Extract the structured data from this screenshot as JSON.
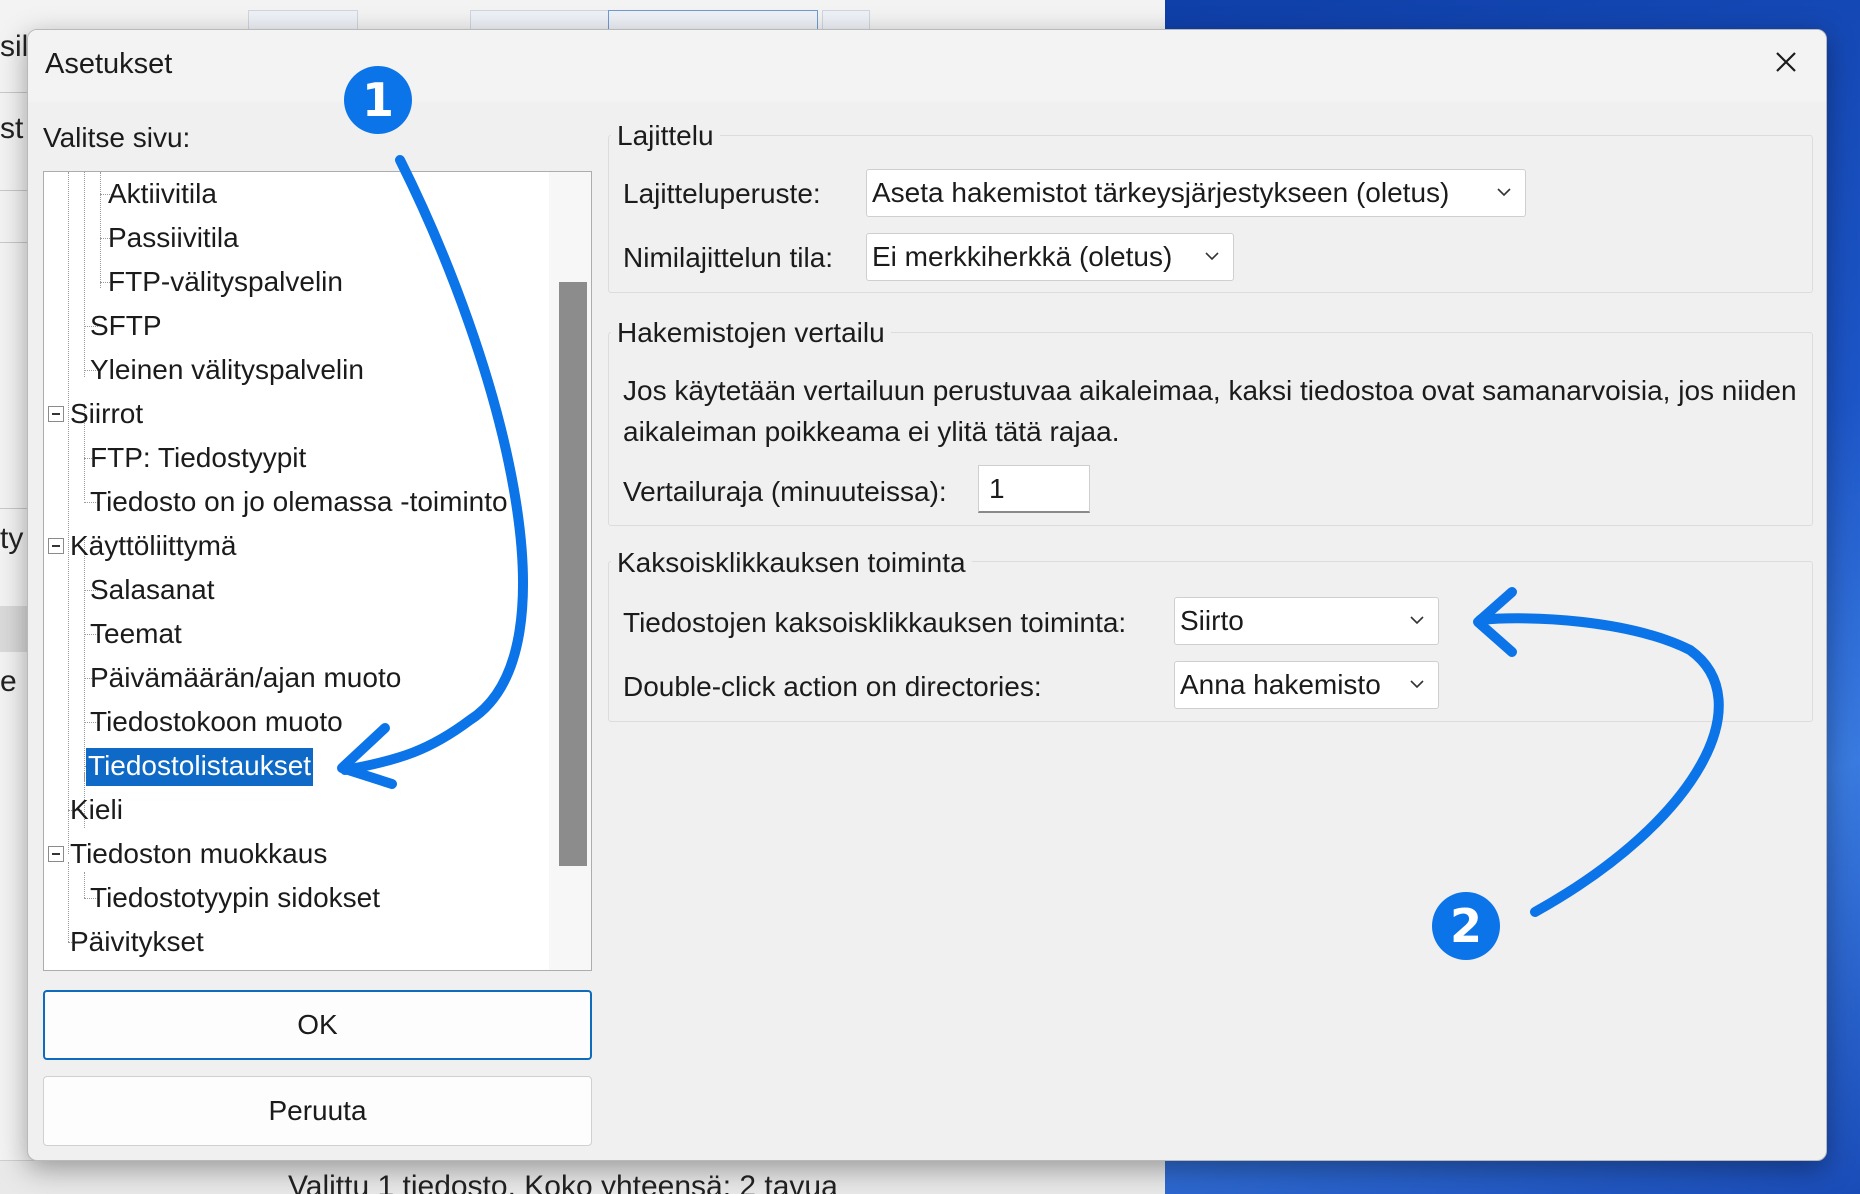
{
  "background": {
    "edge_fragments": [
      "sil",
      "st",
      "ty",
      "e"
    ],
    "status_text": "Valittu 1 tiedosto. Koko yhteensä: 2 tavua"
  },
  "dialog": {
    "title": "Asetukset",
    "select_page_label": "Valitse sivu:",
    "tree": [
      {
        "label": "Aktiivitila",
        "level": 3
      },
      {
        "label": "Passiivitila",
        "level": 3
      },
      {
        "label": "FTP-välityspalvelin",
        "level": 3
      },
      {
        "label": "SFTP",
        "level": 2
      },
      {
        "label": "Yleinen välityspalvelin",
        "level": 2
      },
      {
        "label": "Siirrot",
        "level": 1,
        "expanded": true
      },
      {
        "label": "FTP: Tiedostyypit",
        "level": 2
      },
      {
        "label": "Tiedosto on jo olemassa -toiminto",
        "level": 2
      },
      {
        "label": "Käyttöliittymä",
        "level": 1,
        "expanded": true
      },
      {
        "label": "Salasanat",
        "level": 2
      },
      {
        "label": "Teemat",
        "level": 2
      },
      {
        "label": "Päivämäärän/ajan muoto",
        "level": 2
      },
      {
        "label": "Tiedostokoon muoto",
        "level": 2
      },
      {
        "label": "Tiedostolistaukset",
        "level": 2,
        "selected": true
      },
      {
        "label": "Kieli",
        "level": 1
      },
      {
        "label": "Tiedoston muokkaus",
        "level": 1,
        "expanded": true
      },
      {
        "label": "Tiedostotyypin sidokset",
        "level": 2
      },
      {
        "label": "Päivitykset",
        "level": 1
      }
    ],
    "ok_label": "OK",
    "cancel_label": "Peruuta",
    "sorting": {
      "title": "Lajittelu",
      "sort_by_label": "Lajitteluperuste:",
      "sort_by_value": "Aseta hakemistot tärkeysjärjestykseen (oletus)",
      "name_mode_label": "Nimilajittelun tila:",
      "name_mode_value": "Ei merkkiherkkä (oletus)"
    },
    "comparison": {
      "title": "Hakemistojen vertailu",
      "description": "Jos käytetään vertailuun perustuvaa aikaleimaa, kaksi tiedostoa ovat samanarvoisia, jos niiden aikaleiman poikkeama ei ylitä tätä rajaa.",
      "threshold_label": "Vertailuraja (minuuteissa):",
      "threshold_value": "1"
    },
    "doubleclick": {
      "title": "Kaksoisklikkauksen toiminta",
      "files_label": "Tiedostojen kaksoisklikkauksen toiminta:",
      "files_value": "Siirto",
      "dirs_label": "Double-click action on directories:",
      "dirs_value": "Anna hakemisto"
    }
  },
  "annotations": {
    "badge_1": "1",
    "badge_2": "2",
    "color": "#0b74e8"
  }
}
